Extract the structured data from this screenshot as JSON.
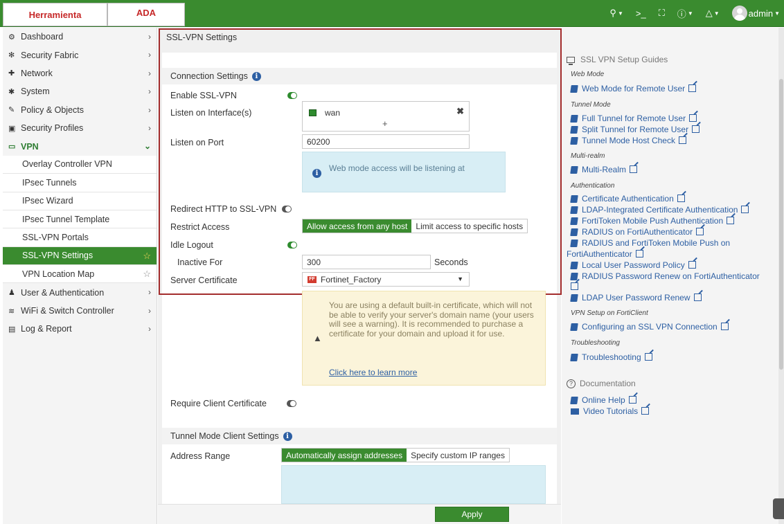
{
  "tabs": {
    "tab1": "Herramienta",
    "tab2": "ADA"
  },
  "topbar": {
    "user": "admin"
  },
  "sidebar": {
    "items": [
      {
        "label": "Dashboard",
        "icon": "dashboard-icon"
      },
      {
        "label": "Security Fabric",
        "icon": "fabric-icon"
      },
      {
        "label": "Network",
        "icon": "network-icon"
      },
      {
        "label": "System",
        "icon": "gear-icon"
      },
      {
        "label": "Policy & Objects",
        "icon": "policy-icon"
      },
      {
        "label": "Security Profiles",
        "icon": "lock-icon"
      },
      {
        "label": "VPN",
        "icon": "monitor-icon"
      }
    ],
    "vpn_subitems": [
      {
        "label": "Overlay Controller VPN"
      },
      {
        "label": "IPsec Tunnels"
      },
      {
        "label": "IPsec Wizard"
      },
      {
        "label": "IPsec Tunnel Template"
      },
      {
        "label": "SSL-VPN Portals"
      },
      {
        "label": "SSL-VPN Settings"
      },
      {
        "label": "VPN Location Map"
      }
    ],
    "bottom_items": [
      {
        "label": "User & Authentication"
      },
      {
        "label": "WiFi & Switch Controller"
      },
      {
        "label": "Log & Report"
      }
    ]
  },
  "page": {
    "title": "SSL-VPN Settings",
    "connection_settings": "Connection Settings",
    "enable_sslvpn": "Enable SSL-VPN",
    "listen_interfaces": "Listen on Interface(s)",
    "interface_value": "wan",
    "listen_port": "Listen on Port",
    "port_value": "60200",
    "web_mode_info": "Web mode access will be listening at",
    "redirect_http": "Redirect HTTP to SSL-VPN",
    "restrict_access": "Restrict Access",
    "allow_any": "Allow access from any host",
    "limit_specific": "Limit access to specific hosts",
    "idle_logout": "Idle Logout",
    "inactive_for": "Inactive For",
    "inactive_value": "300",
    "seconds": "Seconds",
    "server_certificate": "Server Certificate",
    "certificate_value": "Fortinet_Factory",
    "cert_warning": "You are using a default built-in certificate, which will not be able to verify your server's domain name (your users will see a warning). It is recommended to purchase a certificate for your domain and upload it for use.",
    "learn_more": "Click here to learn more",
    "require_client_cert": "Require Client Certificate",
    "tunnel_mode_settings": "Tunnel Mode Client Settings",
    "address_range": "Address Range",
    "auto_assign": "Automatically assign addresses",
    "custom_ranges": "Specify custom IP ranges",
    "apply": "Apply"
  },
  "guides": {
    "title": "SSL VPN Setup Guides",
    "cat_web": "Web Mode",
    "web_remote": "Web Mode for Remote User",
    "cat_tunnel": "Tunnel Mode",
    "full_tunnel": "Full Tunnel for Remote User",
    "split_tunnel": "Split Tunnel for Remote User",
    "host_check": "Tunnel Mode Host Check",
    "cat_multirealm": "Multi-realm",
    "multi_realm": "Multi-Realm",
    "cat_auth": "Authentication",
    "cert_auth": "Certificate Authentication",
    "ldap_cert": "LDAP-Integrated Certificate Authentication",
    "fortitoken_push": "FortiToken Mobile Push Authentication",
    "radius_fac": "RADIUS on FortiAuthenticator",
    "radius_ftm_1": "RADIUS and FortiToken Mobile Push on",
    "radius_ftm_2": "FortiAuthenticator",
    "local_pw": "Local User Password Policy",
    "radius_pw": "RADIUS Password Renew on FortiAuthenticator",
    "ldap_pw": "LDAP User Password Renew",
    "cat_forticlient": "VPN Setup on FortiClient",
    "configuring": "Configuring an SSL VPN Connection",
    "cat_trouble": "Troubleshooting",
    "troubleshooting": "Troubleshooting",
    "documentation": "Documentation",
    "online_help": "Online Help",
    "video_tutorials": "Video Tutorials"
  }
}
